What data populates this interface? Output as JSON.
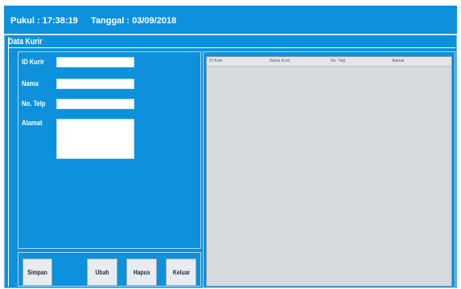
{
  "header": {
    "time": "Pukul : 17:38:19",
    "date": "Tanggal : 03/09/2018"
  },
  "frame": {
    "title": "Data Kurir"
  },
  "form": {
    "id_label": "ID Kurir",
    "nama_label": "Nama",
    "telp_label": "No. Telp",
    "alamat_label": "Alamat",
    "id_value": "",
    "nama_value": "",
    "telp_value": "",
    "alamat_value": ""
  },
  "buttons": {
    "simpan": "Simpan",
    "ubah": "Ubah",
    "hapus": "Hapus",
    "keluar": "Keluar"
  },
  "table": {
    "columns": [
      "ID Kurir",
      "Nama Kurir",
      "No. Telp",
      "Alamat"
    ],
    "rows": []
  },
  "colors": {
    "background": "#0d91dc",
    "table_bg": "#d6d9de"
  }
}
